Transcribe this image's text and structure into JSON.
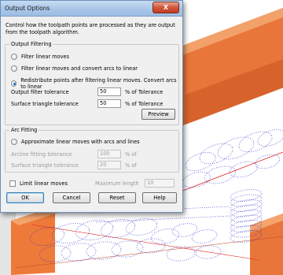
{
  "dialog": {
    "title": "Output Options",
    "close_glyph": "X",
    "description": "Control how the toolpath points are processed as they are output from the toolpath algorithm.",
    "output_filtering": {
      "title": "Output Filtering",
      "options": [
        {
          "label": "Filter linear moves",
          "checked": false
        },
        {
          "label": "Filter linear moves and convert arcs to linear",
          "checked": false
        },
        {
          "label": "Redistribute points after filtering linear moves. Convert arcs to linear",
          "checked": true
        }
      ],
      "output_filter_tolerance": {
        "label": "Output filter tolerance",
        "value": "50",
        "unit": "% of Tolerance"
      },
      "surface_triangle_tolerance": {
        "label": "Surface triangle tolerance",
        "value": "50",
        "unit": "% of Tolerance"
      },
      "preview_label": "Preview"
    },
    "arc_fitting": {
      "title": "Arc Fitting",
      "option_label": "Approximate linear moves with arcs and lines",
      "arcline_fitting_tolerance": {
        "label": "Arcline fitting tolerance",
        "value": "100",
        "unit": "% of"
      },
      "surface_triangle_tolerance": {
        "label": "Surface triangle tolerance",
        "value": "20",
        "unit": "% of"
      }
    },
    "limit_linear_moves": {
      "label": "Limit linear moves",
      "maximum_length_label": "Maximum length",
      "value": "10"
    },
    "buttons": {
      "ok": "OK",
      "cancel": "Cancel",
      "reset": "Reset",
      "help": "Help"
    }
  },
  "colors": {
    "workpiece_orange": "#f07a35",
    "toolpath_blue": "#1616c8",
    "axis_red": "#e02020"
  }
}
